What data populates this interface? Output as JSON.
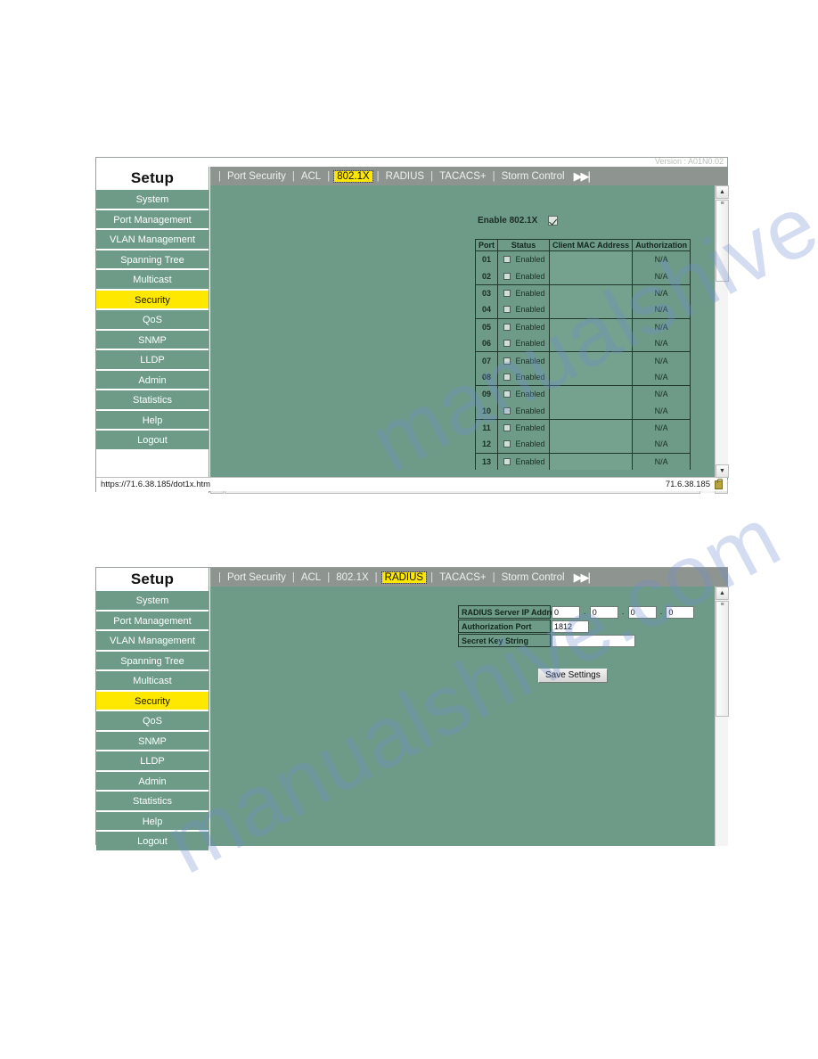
{
  "meta": {
    "version_text": "Version : A01N0.02",
    "watermark": "manualshive.com"
  },
  "sidebar": {
    "title": "Setup",
    "items": [
      {
        "label": "System",
        "active": false
      },
      {
        "label": "Port Management",
        "active": false
      },
      {
        "label": "VLAN Management",
        "active": false
      },
      {
        "label": "Spanning Tree",
        "active": false
      },
      {
        "label": "Multicast",
        "active": false
      },
      {
        "label": "Security",
        "active": true
      },
      {
        "label": "QoS",
        "active": false
      },
      {
        "label": "SNMP",
        "active": false
      },
      {
        "label": "LLDP",
        "active": false
      },
      {
        "label": "Admin",
        "active": false
      },
      {
        "label": "Statistics",
        "active": false
      },
      {
        "label": "Help",
        "active": false
      },
      {
        "label": "Logout",
        "active": false
      }
    ]
  },
  "panel1": {
    "tabs": [
      {
        "label": "Port Security",
        "active": false
      },
      {
        "label": "ACL",
        "active": false
      },
      {
        "label": "802.1X",
        "active": true
      },
      {
        "label": "RADIUS",
        "active": false
      },
      {
        "label": "TACACS+",
        "active": false
      },
      {
        "label": "Storm Control",
        "active": false
      }
    ],
    "skip_icon": "skip-forward-icon",
    "enable_label": "Enable 802.1X",
    "enable_checked": true,
    "table": {
      "headers": [
        "Port",
        "Status",
        "Client MAC Address",
        "Authorization"
      ],
      "rows": [
        {
          "port": "01",
          "status": "Enabled",
          "checked": false,
          "mac": "",
          "auth": "N/A"
        },
        {
          "port": "02",
          "status": "Enabled",
          "checked": false,
          "mac": "",
          "auth": "N/A"
        },
        {
          "port": "03",
          "status": "Enabled",
          "checked": false,
          "mac": "",
          "auth": "N/A"
        },
        {
          "port": "04",
          "status": "Enabled",
          "checked": false,
          "mac": "",
          "auth": "N/A"
        },
        {
          "port": "05",
          "status": "Enabled",
          "checked": false,
          "mac": "",
          "auth": "N/A"
        },
        {
          "port": "06",
          "status": "Enabled",
          "checked": false,
          "mac": "",
          "auth": "N/A"
        },
        {
          "port": "07",
          "status": "Enabled",
          "checked": false,
          "mac": "",
          "auth": "N/A"
        },
        {
          "port": "08",
          "status": "Enabled",
          "checked": false,
          "mac": "",
          "auth": "N/A"
        },
        {
          "port": "09",
          "status": "Enabled",
          "checked": false,
          "mac": "",
          "auth": "N/A"
        },
        {
          "port": "10",
          "status": "Enabled",
          "checked": false,
          "mac": "",
          "auth": "N/A"
        },
        {
          "port": "11",
          "status": "Enabled",
          "checked": false,
          "mac": "",
          "auth": "N/A"
        },
        {
          "port": "12",
          "status": "Enabled",
          "checked": false,
          "mac": "",
          "auth": "N/A"
        },
        {
          "port": "13",
          "status": "Enabled",
          "checked": false,
          "mac": "",
          "auth": "N/A"
        }
      ]
    },
    "statusbar": {
      "url": "https://71.6.38.185/dot1x.htm",
      "zone": "71.6.38.185",
      "lock_icon": "lock-icon"
    }
  },
  "panel2": {
    "tabs": [
      {
        "label": "Port Security",
        "active": false
      },
      {
        "label": "ACL",
        "active": false
      },
      {
        "label": "802.1X",
        "active": false
      },
      {
        "label": "RADIUS",
        "active": true
      },
      {
        "label": "TACACS+",
        "active": false
      },
      {
        "label": "Storm Control",
        "active": false
      }
    ],
    "skip_icon": "skip-forward-icon",
    "form": {
      "ip_label": "RADIUS Server IP Address",
      "ip_octets": [
        "0",
        "0",
        "0",
        "0"
      ],
      "port_label": "Authorization Port",
      "port_value": "1812",
      "secret_label": "Secret Key String",
      "secret_value": "",
      "save_label": "Save Settings"
    }
  },
  "colors": {
    "page_bg": "#6d9b88",
    "tabbar": "#8e9590",
    "accent_yellow": "#ffe800",
    "sidebar_item": "#6d9b88"
  }
}
